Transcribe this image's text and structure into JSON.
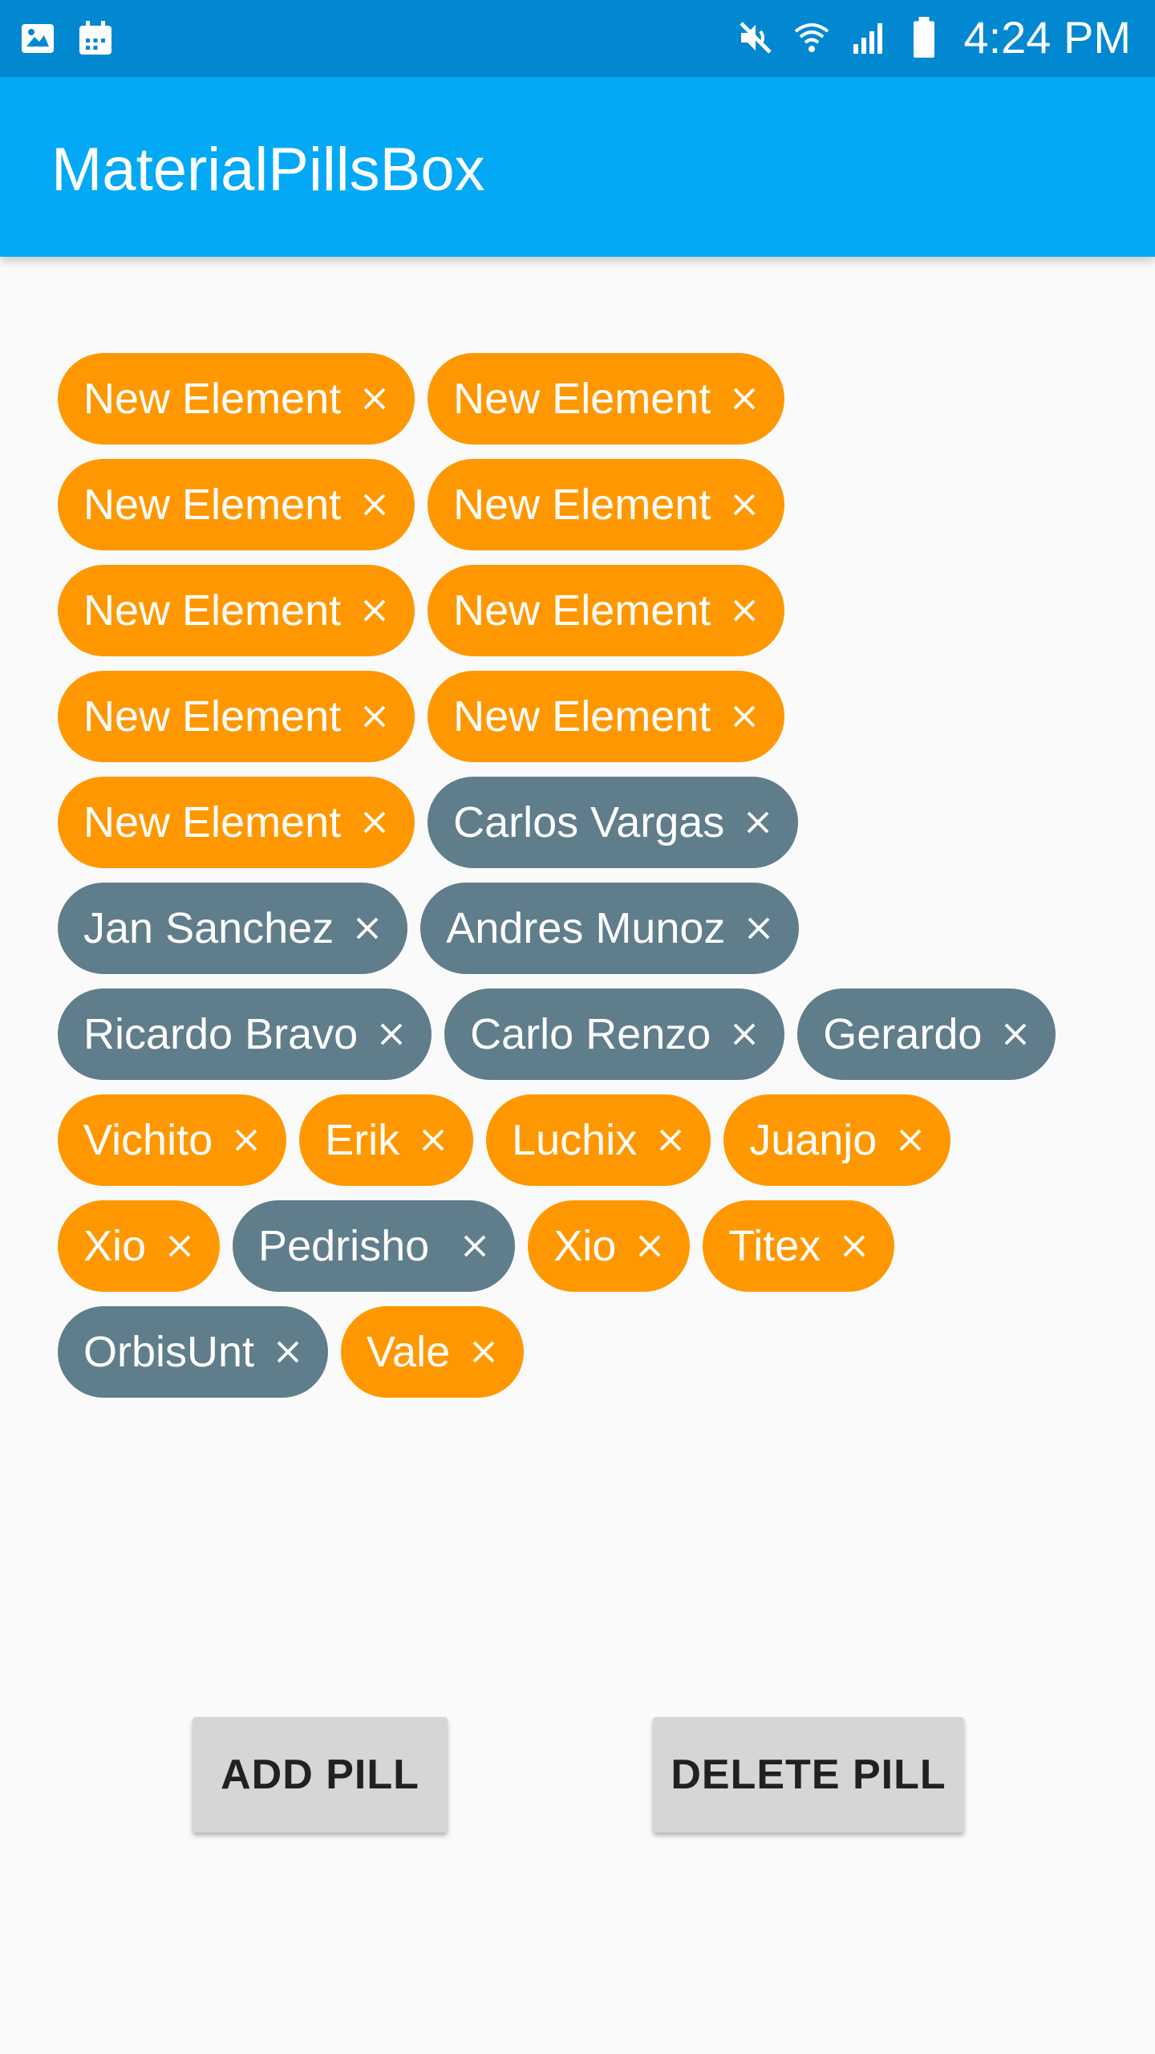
{
  "status_bar": {
    "time": "4:24 PM",
    "left_icons": [
      "image-icon",
      "calendar-icon"
    ],
    "right_icons": [
      "mute-icon",
      "wifi-icon",
      "signal-icon",
      "battery-icon"
    ]
  },
  "app_bar": {
    "title": "MaterialPillsBox",
    "color": "#03a9f4"
  },
  "colors": {
    "status_bar": "#0288d1",
    "pill_orange": "#ff9800",
    "pill_gray": "#607d8b",
    "button_bg": "#d6d6d6"
  },
  "pills": [
    {
      "label": "New Element",
      "color": "orange"
    },
    {
      "label": "New Element",
      "color": "orange"
    },
    {
      "label": "New Element",
      "color": "orange"
    },
    {
      "label": "New Element",
      "color": "orange"
    },
    {
      "label": "New Element",
      "color": "orange"
    },
    {
      "label": "New Element",
      "color": "orange"
    },
    {
      "label": "New Element",
      "color": "orange"
    },
    {
      "label": "New Element",
      "color": "orange"
    },
    {
      "label": "New Element",
      "color": "orange"
    },
    {
      "label": "Carlos Vargas",
      "color": "gray"
    },
    {
      "label": "Jan Sanchez",
      "color": "gray"
    },
    {
      "label": "Andres Munoz",
      "color": "gray"
    },
    {
      "label": "Ricardo Bravo",
      "color": "gray"
    },
    {
      "label": "Carlo Renzo",
      "color": "gray"
    },
    {
      "label": "Gerardo",
      "color": "gray"
    },
    {
      "label": "Vichito",
      "color": "orange"
    },
    {
      "label": "Erik",
      "color": "orange"
    },
    {
      "label": "Luchix",
      "color": "orange"
    },
    {
      "label": "Juanjo",
      "color": "orange"
    },
    {
      "label": "Xio",
      "color": "orange"
    },
    {
      "label": "Pedrisho ",
      "color": "gray"
    },
    {
      "label": "Xio",
      "color": "orange"
    },
    {
      "label": "Titex",
      "color": "orange"
    },
    {
      "label": "OrbisUnt",
      "color": "gray"
    },
    {
      "label": "Vale",
      "color": "orange"
    }
  ],
  "buttons": {
    "add_label": "ADD PILL",
    "delete_label": "DELETE PILL"
  }
}
